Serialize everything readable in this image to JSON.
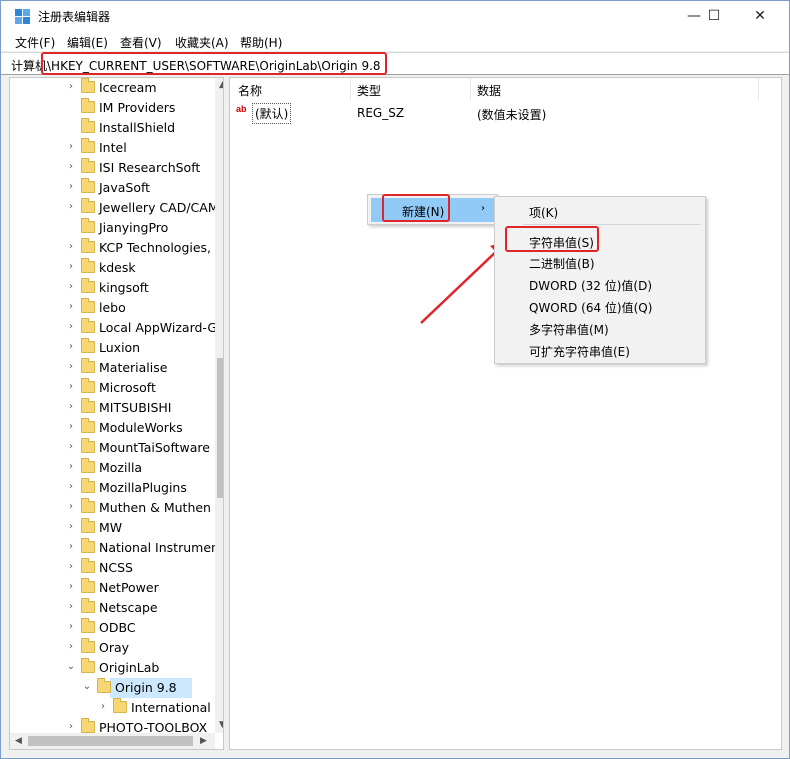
{
  "window": {
    "title": "注册表编辑器",
    "minimize": "—",
    "maximize": "☐",
    "close": "✕"
  },
  "menu": [
    "文件(F)",
    "编辑(E)",
    "查看(V)",
    "收藏夹(A)",
    "帮助(H)"
  ],
  "address": {
    "prefix": "计算机",
    "path": "\\HKEY_CURRENT_USER\\SOFTWARE\\OriginLab\\Origin 9.8"
  },
  "tree": {
    "items": [
      {
        "label": "Icecream",
        "expand": "›"
      },
      {
        "label": "IM Providers",
        "expand": ""
      },
      {
        "label": "InstallShield",
        "expand": ""
      },
      {
        "label": "Intel",
        "expand": "›"
      },
      {
        "label": "ISI ResearchSoft",
        "expand": "›"
      },
      {
        "label": "JavaSoft",
        "expand": "›"
      },
      {
        "label": "Jewellery CAD/CAM",
        "expand": "›"
      },
      {
        "label": "JianyingPro",
        "expand": ""
      },
      {
        "label": "KCP Technologies,",
        "expand": "›"
      },
      {
        "label": "kdesk",
        "expand": "›"
      },
      {
        "label": "kingsoft",
        "expand": "›"
      },
      {
        "label": "lebo",
        "expand": "›"
      },
      {
        "label": "Local AppWizard-G",
        "expand": "›"
      },
      {
        "label": "Luxion",
        "expand": "›"
      },
      {
        "label": "Materialise",
        "expand": "›"
      },
      {
        "label": "Microsoft",
        "expand": "›"
      },
      {
        "label": "MITSUBISHI",
        "expand": "›"
      },
      {
        "label": "ModuleWorks",
        "expand": "›"
      },
      {
        "label": "MountTaiSoftware",
        "expand": "›"
      },
      {
        "label": "Mozilla",
        "expand": "›"
      },
      {
        "label": "MozillaPlugins",
        "expand": "›"
      },
      {
        "label": "Muthen & Muthen",
        "expand": "›"
      },
      {
        "label": "MW",
        "expand": "›"
      },
      {
        "label": "National Instrumen",
        "expand": "›"
      },
      {
        "label": "NCSS",
        "expand": "›"
      },
      {
        "label": "NetPower",
        "expand": "›"
      },
      {
        "label": "Netscape",
        "expand": "›"
      },
      {
        "label": "ODBC",
        "expand": "›"
      },
      {
        "label": "Oray",
        "expand": "›"
      },
      {
        "label": "OriginLab",
        "expand": "⌄"
      },
      {
        "label": "Origin 9.8",
        "expand": "⌄"
      },
      {
        "label": "International",
        "expand": "›"
      },
      {
        "label": "PHOTO-TOOLBOX",
        "expand": "›"
      }
    ]
  },
  "list": {
    "headers": {
      "name": "名称",
      "type": "类型",
      "data": "数据"
    },
    "rows": [
      {
        "icon": "ab",
        "name": "(默认)",
        "type": "REG_SZ",
        "data": "(数值未设置)"
      }
    ]
  },
  "context_menu": {
    "new_label": "新建(N)",
    "new_arrow": "›",
    "submenu": [
      "项(K)",
      "字符串值(S)",
      "二进制值(B)",
      "DWORD (32 位)值(D)",
      "QWORD (64 位)值(Q)",
      "多字符串值(M)",
      "可扩充字符串值(E)"
    ]
  },
  "colors": {
    "highlight_border": "#e0252a",
    "menu_highlight": "#91c9f7",
    "selected_item": "#cce8ff",
    "annotation_arrow": "#e0252a"
  }
}
